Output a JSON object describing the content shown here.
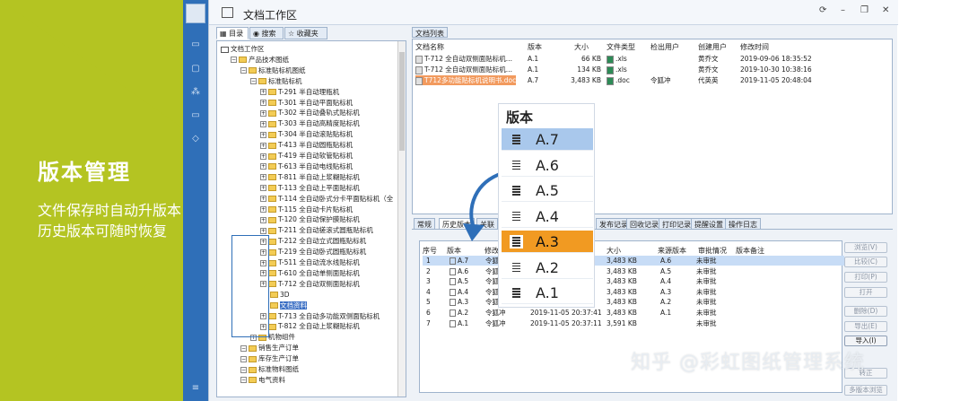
{
  "hero": {
    "title": "版本管理",
    "line1": "文件保存时自动升版本",
    "line2": "历史版本可随时恢复"
  },
  "window": {
    "title": "文档工作区"
  },
  "left_tabs": [
    "目录",
    "搜索",
    "收藏夹"
  ],
  "tree": [
    {
      "label": "文档工作区",
      "level": 0,
      "type": "root"
    },
    {
      "label": "产品技术图纸",
      "level": 1,
      "type": "folder"
    },
    {
      "label": "标准贴标机图纸",
      "level": 2,
      "type": "folder"
    },
    {
      "label": "标准贴标机",
      "level": 3,
      "type": "folder"
    },
    {
      "label": "T-291 半自动理瓶机",
      "level": 4,
      "type": "item"
    },
    {
      "label": "T-301 半自动平面贴标机",
      "level": 4,
      "type": "item"
    },
    {
      "label": "T-302 半自动叠轨式贴标机",
      "level": 4,
      "type": "item"
    },
    {
      "label": "T-303 半自动高精度贴标机",
      "level": 4,
      "type": "item"
    },
    {
      "label": "T-304 半自动滚贴贴标机",
      "level": 4,
      "type": "item"
    },
    {
      "label": "T-413 半自动圆瓶贴标机",
      "level": 4,
      "type": "item"
    },
    {
      "label": "T-419 半自动软管贴标机",
      "level": 4,
      "type": "item"
    },
    {
      "label": "T-613 半自动电线贴标机",
      "level": 4,
      "type": "item"
    },
    {
      "label": "T-811 半自动上浆糊贴标机",
      "level": 4,
      "type": "item"
    },
    {
      "label": "T-113 全自动上平面贴标机",
      "level": 4,
      "type": "item"
    },
    {
      "label": "T-114 全自动卧式分卡平面贴标机（全",
      "level": 4,
      "type": "item"
    },
    {
      "label": "T-115 全自动卡片贴标机",
      "level": 4,
      "type": "item"
    },
    {
      "label": "T-120 全自动保护膜贴标机",
      "level": 4,
      "type": "item"
    },
    {
      "label": "T-211 全自动搓滚式圆瓶贴标机",
      "level": 4,
      "type": "item"
    },
    {
      "label": "T-212 全自动立式圆瓶贴标机",
      "level": 4,
      "type": "item"
    },
    {
      "label": "T-219 全自动卧式圆瓶贴标机",
      "level": 4,
      "type": "item"
    },
    {
      "label": "T-511 全自动流水线贴标机",
      "level": 4,
      "type": "item"
    },
    {
      "label": "T-610 全自动单侧面贴标机",
      "level": 4,
      "type": "item"
    },
    {
      "label": "T-712 全自动双侧面贴标机",
      "level": 4,
      "type": "item"
    },
    {
      "label": "3D",
      "level": 5,
      "type": "folder"
    },
    {
      "label": "文档资料",
      "level": 5,
      "type": "folder",
      "selected": true
    },
    {
      "label": "T-713 全自动多功能双侧面贴标机",
      "level": 4,
      "type": "item"
    },
    {
      "label": "T-812 全自动上浆糊贴标机",
      "level": 4,
      "type": "item"
    },
    {
      "label": "机物组件",
      "level": 3,
      "type": "folder"
    },
    {
      "label": "销售生产订单",
      "level": 2,
      "type": "folder"
    },
    {
      "label": "库存生产订单",
      "level": 2,
      "type": "folder"
    },
    {
      "label": "标准物料图纸",
      "level": 2,
      "type": "folder"
    },
    {
      "label": "电气资料",
      "level": 2,
      "type": "folder"
    }
  ],
  "doclist": {
    "tab": "文档列表",
    "headers": [
      "文档名称",
      "版本",
      "大小",
      "文件类型",
      "检出用户",
      "创建用户",
      "修改时间"
    ],
    "rows": [
      {
        "name": "T-712 全自动双侧面贴标机...",
        "ver": "A.1",
        "size": "66 KB",
        "type": ".xls",
        "checkout": "",
        "creator": "黄乔文",
        "mtime": "2019-09-06 18:35:52",
        "hl": false
      },
      {
        "name": "T-712 全自动双侧面贴标机...",
        "ver": "A.1",
        "size": "134 KB",
        "type": ".xls",
        "checkout": "",
        "creator": "黄乔文",
        "mtime": "2019-10-30 10:38:16",
        "hl": false
      },
      {
        "name": "T712多功能贴标机说明书.doc",
        "ver": "A.7",
        "size": "3,483 KB",
        "type": ".doc",
        "checkout": "令狐冲",
        "creator": "代英英",
        "mtime": "2019-11-05 20:48:04",
        "hl": true
      }
    ]
  },
  "bottom_tabs": [
    "常规",
    "历史版本",
    "关联",
    "发布记录",
    "回收记录",
    "打印记录",
    "提醒设置",
    "操作日志"
  ],
  "history": {
    "headers": [
      "序号",
      "版本",
      "修改",
      "大小",
      "来源版本",
      "审批情况",
      "版本备注"
    ],
    "rows": [
      {
        "idx": "1",
        "ver": "A.7",
        "user": "令狐",
        "time": "",
        "size": "3,483 KB",
        "src": "A.6",
        "appr": "未审批"
      },
      {
        "idx": "2",
        "ver": "A.6",
        "user": "令狐",
        "time": "",
        "size": "3,483 KB",
        "src": "A.5",
        "appr": "未审批"
      },
      {
        "idx": "3",
        "ver": "A.5",
        "user": "令狐",
        "time": "",
        "size": "3,483 KB",
        "src": "A.4",
        "appr": "未审批"
      },
      {
        "idx": "4",
        "ver": "A.4",
        "user": "令狐",
        "time": "",
        "size": "3,483 KB",
        "src": "A.3",
        "appr": "未审批"
      },
      {
        "idx": "5",
        "ver": "A.3",
        "user": "令狐",
        "time": "",
        "size": "3,483 KB",
        "src": "A.2",
        "appr": "未审批"
      },
      {
        "idx": "6",
        "ver": "A.2",
        "user": "令狐冲",
        "time": "2019-11-05 20:37:41",
        "size": "3,483 KB",
        "src": "A.1",
        "appr": "未审批"
      },
      {
        "idx": "7",
        "ver": "A.1",
        "user": "令狐冲",
        "time": "2019-11-05 20:37:11",
        "size": "3,591 KB",
        "src": "",
        "appr": "未审批"
      }
    ]
  },
  "side_buttons": [
    {
      "label": "浏览(V)",
      "enabled": false
    },
    {
      "label": "比较(C)",
      "enabled": false
    },
    {
      "label": "打印(P)",
      "enabled": false
    },
    {
      "label": "打开",
      "enabled": false
    },
    {
      "label": "删除(D)",
      "enabled": false
    },
    {
      "label": "导出(E)",
      "enabled": false
    },
    {
      "label": "导入(I)",
      "enabled": true
    },
    {
      "label": "转正",
      "enabled": false
    },
    {
      "label": "多版本浏览",
      "enabled": false
    }
  ],
  "popup": {
    "title": "版本",
    "versions": [
      "A.7",
      "A.6",
      "A.5",
      "A.4",
      "A.3",
      "A.2",
      "A.1"
    ]
  },
  "watermark": "知乎 @彩虹图纸管理系统",
  "colors": {
    "hero_bg": "#b4c422",
    "sidebar": "#2f6fb8",
    "popup_top": "#a9c8ec",
    "popup_hot": "#f19a22"
  }
}
